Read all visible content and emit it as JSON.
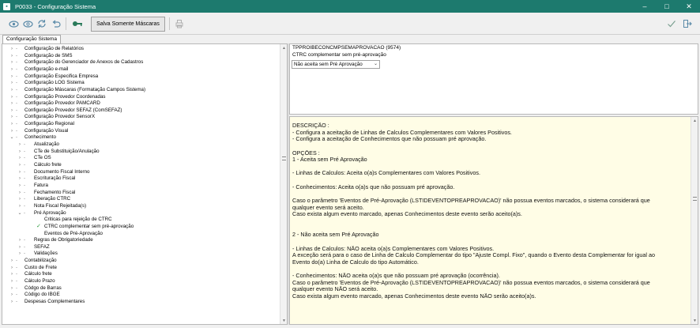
{
  "window": {
    "title": "P0033 - Configuração Sistema",
    "controls": [
      "minimize",
      "maximize",
      "close"
    ]
  },
  "toolbar": {
    "icons": [
      "view-icon",
      "view-alt-icon",
      "refresh-icon",
      "undo-icon",
      "key-icon",
      "print-icon",
      "confirm-icon",
      "exit-icon"
    ],
    "save_masks_label": "Salva Somente Máscaras"
  },
  "tabs": [
    {
      "label": "Configuração Sistema"
    }
  ],
  "tree": {
    "items": [
      {
        "label": "Configuração de Relatórios",
        "level": 0,
        "chev": "›"
      },
      {
        "label": "Configuração de SMS",
        "level": 0,
        "chev": "›"
      },
      {
        "label": "Configuração do Gerenciador de Anexos de Cadastros",
        "level": 0,
        "chev": "›"
      },
      {
        "label": "Configuração e-mail",
        "level": 0,
        "chev": "›"
      },
      {
        "label": "Configuração Especifica Empresa",
        "level": 0,
        "chev": "›"
      },
      {
        "label": "Configuração LOG Sistema",
        "level": 0,
        "chev": "›"
      },
      {
        "label": "Configuração Máscaras (Formatação Campos Sistema)",
        "level": 0,
        "chev": "›"
      },
      {
        "label": "Configuração Provedor Coordenadas",
        "level": 0,
        "chev": "›"
      },
      {
        "label": "Configuração Provedor PAMCARD",
        "level": 0,
        "chev": "›"
      },
      {
        "label": "Configuração Provedor SEFAZ (ComSEFAZ)",
        "level": 0,
        "chev": "›"
      },
      {
        "label": "Configuração Provedor SensorX",
        "level": 0,
        "chev": "›"
      },
      {
        "label": "Configuração Regional",
        "level": 0,
        "chev": "›"
      },
      {
        "label": "Configuração Visual",
        "level": 0,
        "chev": "›"
      },
      {
        "label": "Conhecimento",
        "level": 0,
        "chev": "⌄"
      },
      {
        "label": "Atualização",
        "level": 1,
        "chev": "›"
      },
      {
        "label": "CTe de Substituição/Anulação",
        "level": 1,
        "chev": "›"
      },
      {
        "label": "CTe OS",
        "level": 1,
        "chev": "›"
      },
      {
        "label": "Cálculo frete",
        "level": 1,
        "chev": "›"
      },
      {
        "label": "Documento Fiscal Interno",
        "level": 1,
        "chev": "›"
      },
      {
        "label": "Escrituração Fiscal",
        "level": 1,
        "chev": "›"
      },
      {
        "label": "Fatura",
        "level": 1,
        "chev": "›"
      },
      {
        "label": "Fechamento Fiscal",
        "level": 1,
        "chev": "›"
      },
      {
        "label": "Liberação CTRC",
        "level": 1,
        "chev": "›"
      },
      {
        "label": "Nota Fiscal Rejeitada(s)",
        "level": 1,
        "chev": "›"
      },
      {
        "label": "Pré Aprovação",
        "level": 1,
        "chev": "⌄"
      },
      {
        "label": "Criticas para rejeição de CTRC",
        "level": 2,
        "chev": ""
      },
      {
        "label": "CTRC complementar sem pré-aprovação",
        "level": 2,
        "chev": "",
        "selected": true
      },
      {
        "label": "Eventos de Pré-Aprovação",
        "level": 2,
        "chev": ""
      },
      {
        "label": "Regras de Obrigatoriedade",
        "level": 1,
        "chev": "›"
      },
      {
        "label": "SEFAZ",
        "level": 1,
        "chev": "›"
      },
      {
        "label": "Validações",
        "level": 1,
        "chev": "›"
      },
      {
        "label": "Contabilização",
        "level": 0,
        "chev": "›"
      },
      {
        "label": "Custo de Frete",
        "level": 0,
        "chev": "›"
      },
      {
        "label": "Cálculo frete",
        "level": 0,
        "chev": "›"
      },
      {
        "label": "Cálculo Prazo",
        "level": 0,
        "chev": "›"
      },
      {
        "label": "Códgo de Barras",
        "level": 0,
        "chev": "›"
      },
      {
        "label": "Código do IBGE",
        "level": 0,
        "chev": "›"
      },
      {
        "label": "Despesas Complementares",
        "level": 0,
        "chev": "›"
      }
    ]
  },
  "param": {
    "title": "TPPROIBECONCMPSEMAPROVACAO (9574)",
    "subtitle": "CTRC complementar sem pré-aprovação",
    "selected_value": "Não aceita sem Pré Aprovação"
  },
  "description": {
    "lines": [
      "DESCRIÇÃO :",
      "- Configura a aceitação de Linhas de Calculos Complementares com Valores Positivos.",
      "- Configura a aceitação de Conhecimentos que não possuam pré aprovação.",
      "",
      "OPÇÕES :",
      "1 - Aceita sem Pré Aprovação",
      "",
      "- Linhas de Calculos: Aceita o(a)s Complementares com Valores Positivos.",
      "",
      "- Conhecimentos: Aceita o(a)s que não possuam pré aprovação.",
      "",
      "Caso o parâmetro 'Eventos de Pré-Aprovação (LSTIDEVENTOPREAPROVACAO)' não possua eventos marcados, o sistema considerará que",
      "qualquer evento será aceito.",
      "Caso exista algum evento marcado, apenas Conhecimentos deste evento serão aceito(a)s.",
      "",
      "",
      "2 - Não aceita sem Pré Aprovação",
      "",
      "- Linhas de Calculos: NÃO aceita o(a)s Complementares com Valores Positivos.",
      "A exceção será para o caso de Linha de Calculo Complementar do tipo \"Ajuste Compl. Fixo\", quando o Evento desta Complementar for igual ao",
      "Evento do(a) Linha de Calculo do tipo Automático.",
      "",
      "- Conhecimentos: NÃO aceita o(a)s que não possuam pré aprovação (ocorrência).",
      "Caso o parâmetro 'Eventos de Pré-Aprovação (LSTIDEVENTOPREAPROVACAO)' não possua eventos marcados, o sistema considerará que",
      "qualquer evento NÃO será aceito.",
      "Caso exista algum evento marcado, apenas Conhecimentos deste evento NÃO serão aceito(a)s."
    ]
  }
}
